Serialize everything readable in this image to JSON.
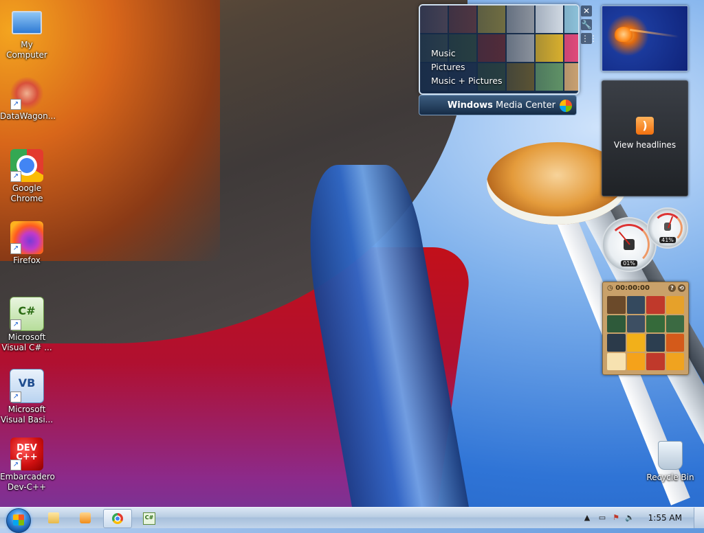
{
  "desktop": {
    "icons": [
      {
        "label": "My Computer",
        "icon": "computer-icon"
      },
      {
        "label": "DataWagon...",
        "icon": "datawagon-icon"
      },
      {
        "label": "Google Chrome",
        "icon": "chrome-icon"
      },
      {
        "label": "Firefox",
        "icon": "firefox-icon"
      },
      {
        "label": "Microsoft Visual C# ...",
        "icon": "visual-csharp-icon"
      },
      {
        "label": "Microsoft Visual Basi...",
        "icon": "visual-basic-icon"
      },
      {
        "label": "Embarcadero Dev-C++",
        "icon": "devcpp-icon"
      },
      {
        "label": "Recycle Bin",
        "icon": "recycle-bin-icon"
      }
    ],
    "vcs_glyph": "C#",
    "vb_glyph": "VB",
    "devcpp_glyph": "DEV C++"
  },
  "media_center": {
    "menu": [
      "Music",
      "Pictures",
      "Music + Pictures"
    ],
    "bar_bold": "Windows",
    "bar_rest": " Media Center"
  },
  "gadget_controls": [
    "✕",
    "🔧",
    "⋮⋮"
  ],
  "feed_gadget": {
    "label": "View headlines"
  },
  "cpu_meter": {
    "cpu_percent": "01%",
    "mem_percent": "41%"
  },
  "puzzle": {
    "timer": "00:00:00"
  },
  "taskbar": {
    "pinned": [
      "folder-icon",
      "media-player-icon",
      "chrome-icon",
      "visual-csharp-icon"
    ],
    "tray_icons": [
      "show-hidden-icons",
      "network-icon",
      "action-center-icon",
      "volume-icon"
    ],
    "clock": "1:55 AM"
  },
  "colors": {
    "taskbar": "#b9cde3",
    "accent": "#1f5fc4"
  }
}
